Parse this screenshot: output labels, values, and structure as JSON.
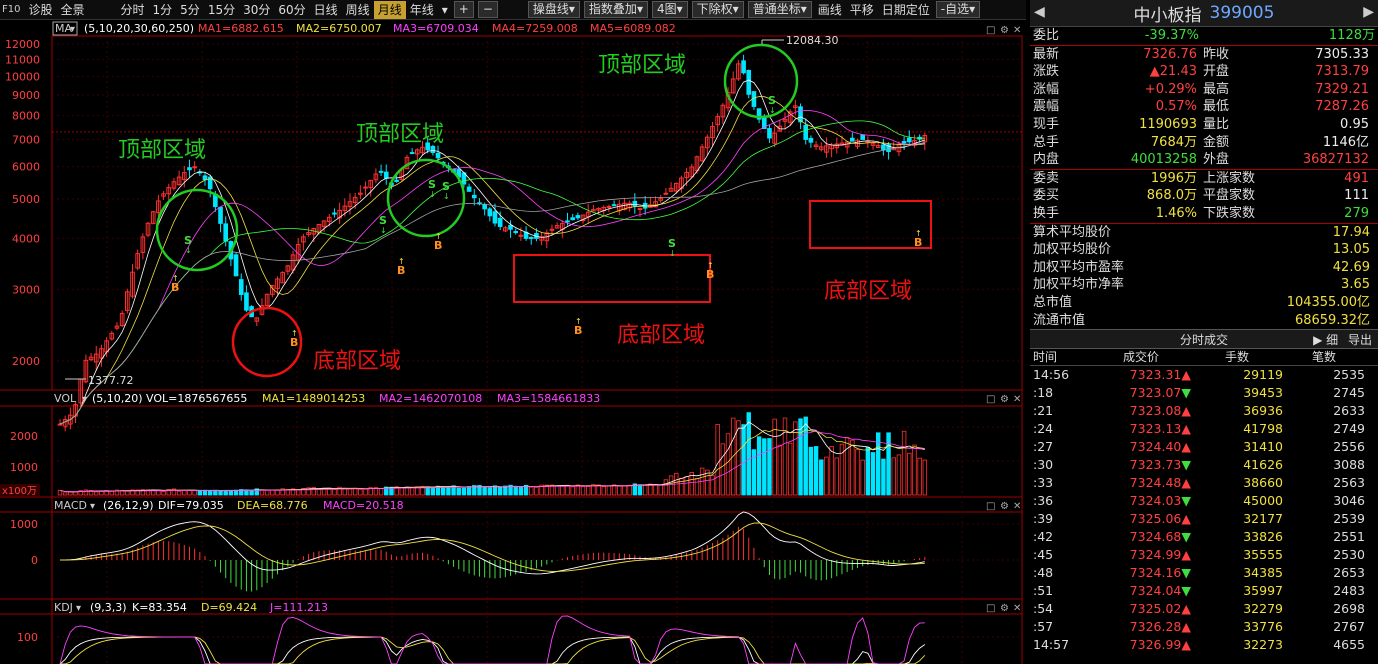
{
  "toolbar": {
    "f10": "F10",
    "items": [
      "诊股",
      "全景"
    ],
    "periods": [
      "分时",
      "1分",
      "5分",
      "15分",
      "30分",
      "60分",
      "日线",
      "周线",
      "月线",
      "年线"
    ],
    "active_period": "月线",
    "buttons": [
      "操盘线",
      "指数叠加",
      "4图",
      "下除权",
      "普通坐标",
      "画线",
      "平移",
      "日期定位",
      "自选"
    ]
  },
  "main_chart": {
    "indicator": "MA",
    "params": "(5,10,20,30,60,250)",
    "ma_labels": [
      "MA1=6882.615",
      "MA2=6750.007",
      "MA3=6709.034",
      "MA4=7259.008",
      "MA5=6089.082"
    ],
    "y_ticks": [
      "12000",
      "11000",
      "10000",
      "9000",
      "8000",
      "7000",
      "6000",
      "5000",
      "4000",
      "3000",
      "2000"
    ],
    "high_label": "12084.30",
    "low_label": "1377.72",
    "annotations": {
      "top": "顶部区域",
      "bottom": "底部区域"
    },
    "signal_s": "S",
    "signal_b": "B"
  },
  "vol_chart": {
    "title": "VOL",
    "params": "(5,10,20)",
    "labels": [
      "VOL=1876567655",
      "MA1=1489014253",
      "MA2=1462070108",
      "MA3=1584661833"
    ],
    "y_ticks": [
      "2000",
      "1000"
    ],
    "unit": "x100万"
  },
  "macd_chart": {
    "title": "MACD",
    "params": "(26,12,9)",
    "labels": [
      "DIF=79.035",
      "DEA=68.776",
      "MACD=20.518"
    ],
    "y_ticks": [
      "1000",
      "0"
    ]
  },
  "kdj_chart": {
    "title": "KDJ",
    "params": "(9,3,3)",
    "labels": [
      "K=83.354",
      "D=69.424",
      "J=111.213"
    ],
    "y_ticks": [
      "100"
    ]
  },
  "quote": {
    "name": "中小板指",
    "code": "399005",
    "weibi": {
      "label": "委比",
      "value": "-39.37%",
      "extra": "1128万"
    },
    "grid": [
      [
        {
          "l": "最新",
          "v": "7326.76",
          "c": "red"
        },
        {
          "l": "昨收",
          "v": "7305.33",
          "c": "white"
        }
      ],
      [
        {
          "l": "涨跌",
          "v": "▲21.43",
          "c": "red"
        },
        {
          "l": "开盘",
          "v": "7313.79",
          "c": "red"
        }
      ],
      [
        {
          "l": "涨幅",
          "v": "+0.29%",
          "c": "red"
        },
        {
          "l": "最高",
          "v": "7329.21",
          "c": "red"
        }
      ],
      [
        {
          "l": "震幅",
          "v": "0.57%",
          "c": "red"
        },
        {
          "l": "最低",
          "v": "7287.26",
          "c": "red"
        }
      ],
      [
        {
          "l": "现手",
          "v": "1190693",
          "c": "yellow"
        },
        {
          "l": "量比",
          "v": "0.95",
          "c": "white"
        }
      ],
      [
        {
          "l": "总手",
          "v": "7684万",
          "c": "yellow"
        },
        {
          "l": "金额",
          "v": "1146亿",
          "c": "white"
        }
      ],
      [
        {
          "l": "内盘",
          "v": "40013258",
          "c": "green"
        },
        {
          "l": "外盘",
          "v": "36827132",
          "c": "red"
        }
      ]
    ],
    "grid2": [
      [
        {
          "l": "委卖",
          "v": "1996万",
          "c": "yellow"
        },
        {
          "l": "上涨家数",
          "v": "491",
          "c": "red"
        }
      ],
      [
        {
          "l": "委买",
          "v": "868.0万",
          "c": "yellow"
        },
        {
          "l": "平盘家数",
          "v": "111",
          "c": "white"
        }
      ],
      [
        {
          "l": "换手",
          "v": "1.46%",
          "c": "yellow"
        },
        {
          "l": "下跌家数",
          "v": "279",
          "c": "green"
        }
      ]
    ],
    "stats": [
      {
        "l": "算术平均股价",
        "v": "17.94"
      },
      {
        "l": "加权平均股价",
        "v": "13.05"
      },
      {
        "l": "加权平均市盈率",
        "v": "42.69"
      },
      {
        "l": "加权平均市净率",
        "v": "3.65"
      },
      {
        "l": "总市值",
        "v": "104355.00亿"
      },
      {
        "l": "流通市值",
        "v": "68659.32亿"
      }
    ]
  },
  "trades": {
    "title": "分时成交",
    "detail": "细",
    "export": "导出",
    "columns": [
      "时间",
      "成交价",
      "手数",
      "笔数"
    ],
    "rows": [
      {
        "t": "14:56",
        "p": "7323.31",
        "d": "up",
        "v": "29119",
        "n": "2535"
      },
      {
        "t": ":18",
        "p": "7323.07",
        "d": "down",
        "v": "39453",
        "n": "2745"
      },
      {
        "t": ":21",
        "p": "7323.08",
        "d": "up",
        "v": "36936",
        "n": "2633"
      },
      {
        "t": ":24",
        "p": "7323.13",
        "d": "up",
        "v": "41798",
        "n": "2749"
      },
      {
        "t": ":27",
        "p": "7324.40",
        "d": "up",
        "v": "31410",
        "n": "2556"
      },
      {
        "t": ":30",
        "p": "7323.73",
        "d": "down",
        "v": "41626",
        "n": "3088"
      },
      {
        "t": ":33",
        "p": "7324.48",
        "d": "up",
        "v": "38660",
        "n": "2563"
      },
      {
        "t": ":36",
        "p": "7324.03",
        "d": "down",
        "v": "45000",
        "n": "3046"
      },
      {
        "t": ":39",
        "p": "7325.06",
        "d": "up",
        "v": "32177",
        "n": "2539"
      },
      {
        "t": ":42",
        "p": "7324.68",
        "d": "down",
        "v": "33826",
        "n": "2551"
      },
      {
        "t": ":45",
        "p": "7324.99",
        "d": "up",
        "v": "35555",
        "n": "2530"
      },
      {
        "t": ":48",
        "p": "7324.16",
        "d": "down",
        "v": "34385",
        "n": "2653"
      },
      {
        "t": ":51",
        "p": "7324.04",
        "d": "down",
        "v": "35997",
        "n": "2483"
      },
      {
        "t": ":54",
        "p": "7325.02",
        "d": "up",
        "v": "32279",
        "n": "2698"
      },
      {
        "t": ":57",
        "p": "7326.28",
        "d": "up",
        "v": "33776",
        "n": "2767"
      },
      {
        "t": "14:57",
        "p": "7326.99",
        "d": "up",
        "v": "32273",
        "n": "4655"
      }
    ]
  },
  "colors": {
    "up": "#ff3030",
    "down": "#00e5ff",
    "ma1": "#ffffff",
    "ma2": "#f0e040",
    "ma3": "#ff40ff",
    "ma4": "#40ff40",
    "ma5": "#a0a0a0",
    "circle_top": "#22cc22",
    "circle_bottom": "#ee1111",
    "box": "#ee1111"
  }
}
